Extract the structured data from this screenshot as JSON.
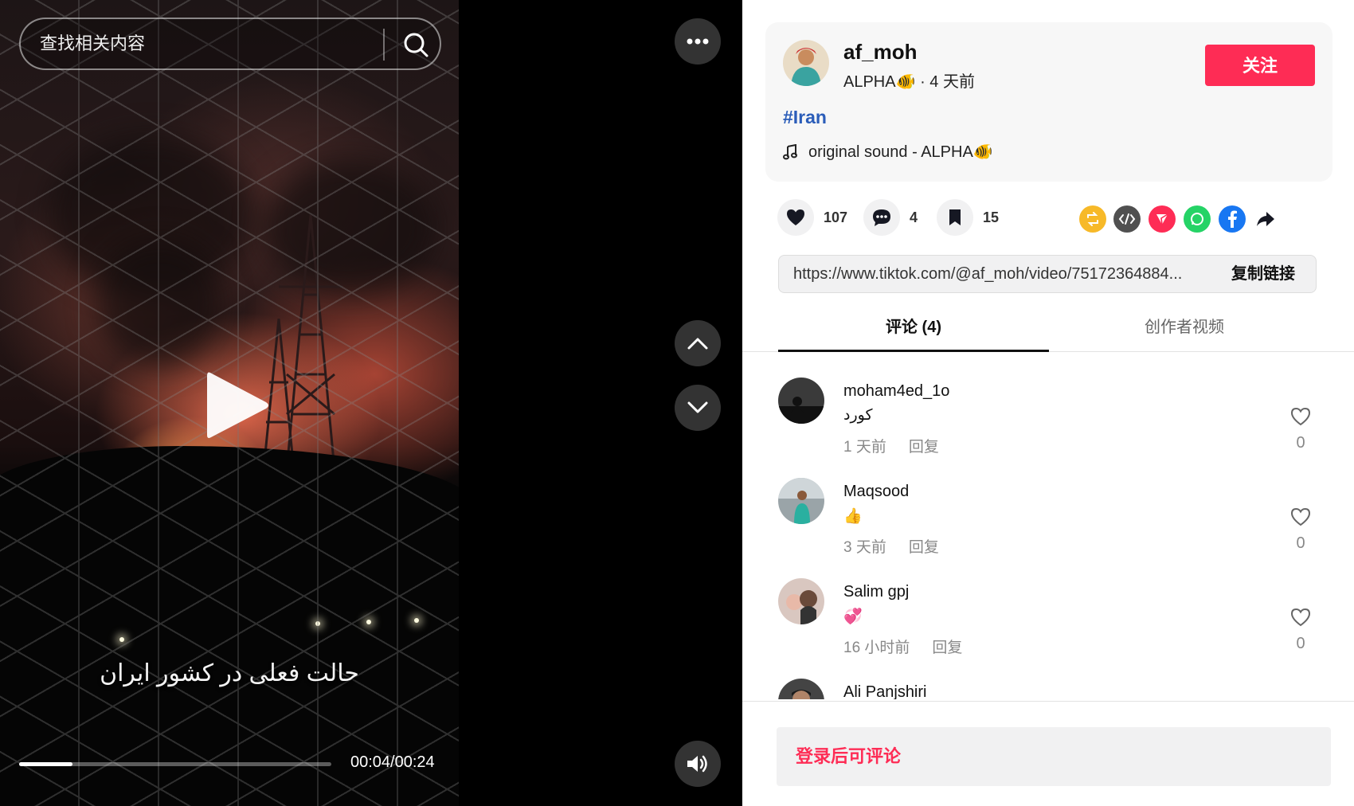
{
  "search": {
    "placeholder": "查找相关内容"
  },
  "video": {
    "caption": "حالت فعلی در کشور ایران",
    "current_time": "00:04",
    "duration": "00:24",
    "time_display": "00:04/00:24",
    "progress_fraction": 0.17
  },
  "icons": {
    "more": "more-dots-icon",
    "prev": "chevron-up-icon",
    "next": "chevron-down-icon",
    "volume": "volume-icon",
    "play": "play-icon",
    "search": "search-icon"
  },
  "author": {
    "username": "af_moh",
    "nickname": "ALPHA🐠",
    "posted": "· 4 天前",
    "follow_label": "关注",
    "hashtag": "#Iran",
    "music": "original sound - ALPHA🐠"
  },
  "stats": {
    "likes": "107",
    "comments": "4",
    "saves": "15"
  },
  "share": {
    "link": "https://www.tiktok.com/@af_moh/video/75172364884...",
    "copy_label": "复制链接",
    "colors": {
      "repost": "#f7b928",
      "embed": "#505050",
      "send": "#fe2c55",
      "whatsapp": "#25d366",
      "facebook": "#1877f2"
    }
  },
  "tabs": {
    "comments": "评论 (4)",
    "creator_videos": "创作者视频"
  },
  "comments": [
    {
      "user": "moham4ed_1o",
      "text": "کورد",
      "time": "1 天前",
      "reply": "回复",
      "likes": "0"
    },
    {
      "user": "Maqsood",
      "text": "👍",
      "time": "3 天前",
      "reply": "回复",
      "likes": "0"
    },
    {
      "user": "Salim gpj",
      "text": "💞",
      "time": "16 小时前",
      "reply": "回复",
      "likes": "0"
    },
    {
      "user": "Ali Panjshiri",
      "text": "",
      "time": "",
      "reply": "",
      "likes": ""
    }
  ],
  "footer": {
    "login_prompt": "登录后可评论"
  },
  "colors": {
    "accent": "#fe2c55",
    "hashtag": "#2b5db9"
  }
}
